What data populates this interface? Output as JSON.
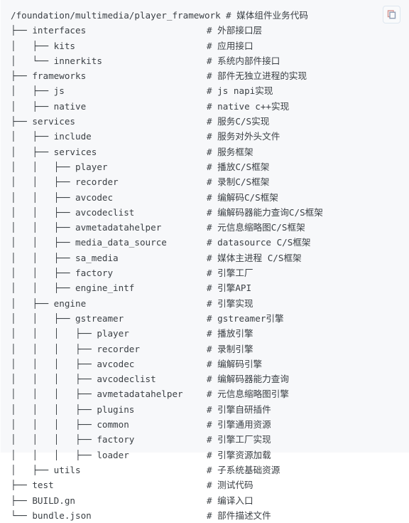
{
  "block": {
    "language": "shell",
    "background_color": "#f7f8fa",
    "text_color": "#3b4045",
    "copy_button": {
      "icon": "copy-icon",
      "label": "",
      "border_color": "#dde6ef",
      "back_square_color": "#d4948f",
      "front_square_color": "#8e9cb3"
    }
  },
  "lines": [
    {
      "tree": "/foundation/multimedia/player_framework",
      "indented": true,
      "comment": "# 媒体组件业务代码"
    },
    {
      "tree": "├── interfaces",
      "indented": false,
      "comment": "# 外部接口层"
    },
    {
      "tree": "│   ├── kits",
      "indented": false,
      "comment": "# 应用接口"
    },
    {
      "tree": "│   └── innerkits",
      "indented": false,
      "comment": "# 系统内部件接口"
    },
    {
      "tree": "├── frameworks",
      "indented": false,
      "comment": "# 部件无独立进程的实现"
    },
    {
      "tree": "│   ├── js",
      "indented": false,
      "comment": "# js napi实现"
    },
    {
      "tree": "│   ├── native",
      "indented": false,
      "comment": "# native c++实现"
    },
    {
      "tree": "├── services",
      "indented": false,
      "comment": "# 服务C/S实现"
    },
    {
      "tree": "│   ├── include",
      "indented": false,
      "comment": "# 服务对外头文件"
    },
    {
      "tree": "│   ├── services",
      "indented": false,
      "comment": "# 服务框架"
    },
    {
      "tree": "│   │   ├── player",
      "indented": false,
      "comment": "# 播放C/S框架"
    },
    {
      "tree": "│   │   ├── recorder",
      "indented": false,
      "comment": "# 录制C/S框架"
    },
    {
      "tree": "│   │   ├── avcodec",
      "indented": false,
      "comment": "# 编解码C/S框架"
    },
    {
      "tree": "│   │   ├── avcodeclist",
      "indented": false,
      "comment": "# 编解码器能力查询C/S框架"
    },
    {
      "tree": "│   │   ├── avmetadatahelper",
      "indented": false,
      "comment": "# 元信息缩略图C/S框架"
    },
    {
      "tree": "│   │   ├── media_data_source",
      "indented": false,
      "comment": "# datasource C/S框架"
    },
    {
      "tree": "│   │   ├── sa_media",
      "indented": false,
      "comment": "# 媒体主进程 C/S框架"
    },
    {
      "tree": "│   │   ├── factory",
      "indented": false,
      "comment": "# 引擎工厂"
    },
    {
      "tree": "│   │   ├── engine_intf",
      "indented": false,
      "comment": "# 引擎API"
    },
    {
      "tree": "│   ├── engine",
      "indented": false,
      "comment": "# 引擎实现"
    },
    {
      "tree": "│   │   ├── gstreamer",
      "indented": false,
      "comment": "# gstreamer引擎"
    },
    {
      "tree": "│   │   │   ├── player",
      "indented": false,
      "comment": "# 播放引擎"
    },
    {
      "tree": "│   │   │   ├── recorder",
      "indented": false,
      "comment": "# 录制引擎"
    },
    {
      "tree": "│   │   │   ├── avcodec",
      "indented": false,
      "comment": "# 编解码引擎"
    },
    {
      "tree": "│   │   │   ├── avcodeclist",
      "indented": false,
      "comment": "# 编解码器能力查询"
    },
    {
      "tree": "│   │   │   ├── avmetadatahelper",
      "indented": false,
      "comment": "# 元信息缩略图引擎"
    },
    {
      "tree": "│   │   │   ├── plugins",
      "indented": false,
      "comment": "# 引擎自研插件"
    },
    {
      "tree": "│   │   │   ├── common",
      "indented": false,
      "comment": "# 引擎通用资源"
    },
    {
      "tree": "│   │   │   ├── factory",
      "indented": false,
      "comment": "# 引擎工厂实现"
    },
    {
      "tree": "│   │   │   ├── loader",
      "indented": false,
      "comment": "# 引擎资源加载"
    },
    {
      "tree": "│   ├── utils",
      "indented": false,
      "comment": "# 子系统基础资源"
    },
    {
      "tree": "├── test",
      "indented": false,
      "comment": "# 测试代码"
    },
    {
      "tree": "├── BUILD.gn",
      "indented": false,
      "comment": "# 编译入口"
    },
    {
      "tree": "└── bundle.json",
      "indented": false,
      "comment": "# 部件描述文件"
    }
  ]
}
